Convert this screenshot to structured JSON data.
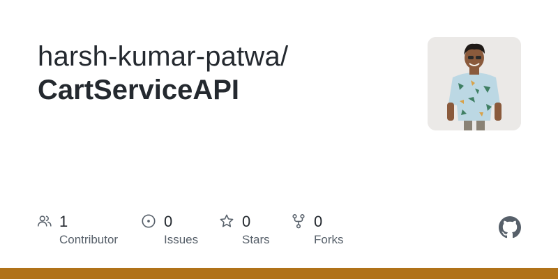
{
  "repo": {
    "owner_path": "harsh-kumar-patwa/",
    "name": "CartServiceAPI"
  },
  "stats": {
    "contributors": {
      "value": "1",
      "label": "Contributor",
      "icon": "people-icon"
    },
    "issues": {
      "value": "0",
      "label": "Issues",
      "icon": "issue-opened-icon"
    },
    "stars": {
      "value": "0",
      "label": "Stars",
      "icon": "star-icon"
    },
    "forks": {
      "value": "0",
      "label": "Forks",
      "icon": "repo-forked-icon"
    }
  },
  "brand": {
    "icon": "github-mark-icon",
    "color": "#57606a"
  },
  "accent": {
    "bar_color": "#b07219"
  }
}
